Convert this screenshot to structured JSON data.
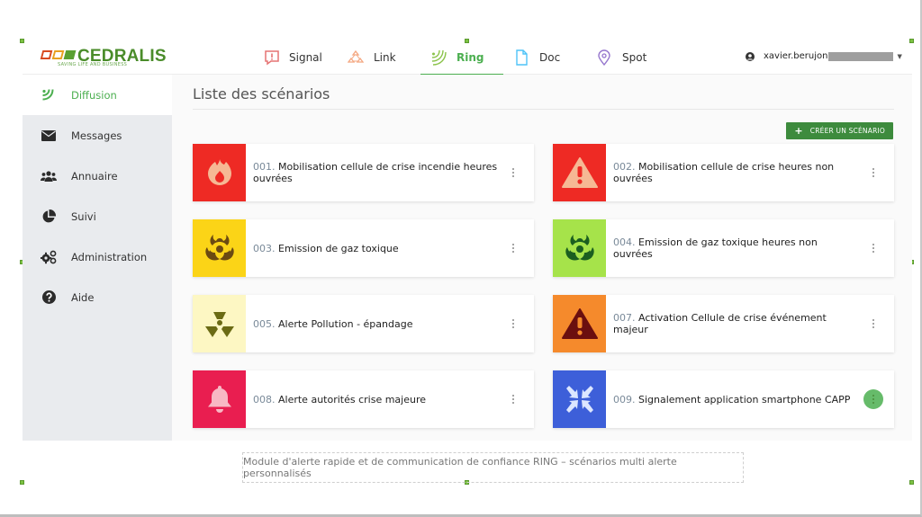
{
  "brand": {
    "name": "CEDRALIS",
    "tagline": "SAVING LIFE AND BUSINESS",
    "mark_colors": [
      "#d84a1f",
      "#e8a020",
      "#5aa032"
    ]
  },
  "nav": {
    "tabs": [
      {
        "label": "Signal",
        "icon": "signal-alert-icon",
        "color": "#e57373",
        "active": false
      },
      {
        "label": "Link",
        "icon": "link-network-icon",
        "color": "#f4a780",
        "active": false
      },
      {
        "label": "Ring",
        "icon": "ring-waves-icon",
        "color": "#8bc34a",
        "active": true
      },
      {
        "label": "Doc",
        "icon": "document-icon",
        "color": "#4fc3f7",
        "active": false
      },
      {
        "label": "Spot",
        "icon": "location-pin-icon",
        "color": "#9575cd",
        "active": false
      }
    ],
    "accent": "#4caf50"
  },
  "user": {
    "name": "xavier.berujon",
    "icon": "user-circle-icon"
  },
  "sidebar": {
    "items": [
      {
        "label": "Diffusion",
        "icon": "broadcast-icon",
        "active": true
      },
      {
        "label": "Messages",
        "icon": "envelope-icon",
        "active": false
      },
      {
        "label": "Annuaire",
        "icon": "users-icon",
        "active": false
      },
      {
        "label": "Suivi",
        "icon": "pie-chart-icon",
        "active": false
      },
      {
        "label": "Administration",
        "icon": "gears-icon",
        "active": false
      },
      {
        "label": "Aide",
        "icon": "question-circle-icon",
        "active": false
      }
    ]
  },
  "main": {
    "title": "Liste des scénarios",
    "create_button": "CRÉER UN SCÉNARIO",
    "scenarios": [
      {
        "num": "001.",
        "label": "Mobilisation cellule de crise incendie heures ouvrées",
        "icon": "fire-icon",
        "bg": "#ee2a24",
        "fg": "#f6b894",
        "menu_highlight": false
      },
      {
        "num": "002.",
        "label": "Mobilisation cellule de crise heures non ouvrées",
        "icon": "warning-triangle-icon",
        "bg": "#ee2a24",
        "fg": "#f6b894",
        "menu_highlight": false
      },
      {
        "num": "003.",
        "label": "Emission de gaz toxique",
        "icon": "biohazard-icon",
        "bg": "#fbd417",
        "fg": "#6b4a12",
        "menu_highlight": false
      },
      {
        "num": "004.",
        "label": "Emission de gaz toxique heures non ouvrées",
        "icon": "biohazard-icon",
        "bg": "#a6e34a",
        "fg": "#1b5e20",
        "menu_highlight": false
      },
      {
        "num": "005.",
        "label": "Alerte Pollution - épandage",
        "icon": "radiation-icon",
        "bg": "#fdf7c3",
        "fg": "#6b6b14",
        "menu_highlight": false
      },
      {
        "num": "007.",
        "label": "Activation Cellule de crise événement majeur",
        "icon": "warning-triangle-icon",
        "bg": "#f58a2c",
        "fg": "#6b0f0f",
        "menu_highlight": false
      },
      {
        "num": "008.",
        "label": "Alerte autorités crise majeure",
        "icon": "bell-icon",
        "bg": "#e91e50",
        "fg": "#f8b8c4",
        "menu_highlight": false
      },
      {
        "num": "009.",
        "label": "Signalement application smartphone CAPP",
        "icon": "compress-arrows-icon",
        "bg": "#3d5fd9",
        "fg": "#dce6ff",
        "menu_highlight": true
      }
    ]
  },
  "caption": "Module d'alerte rapide et de communication de confiance RING – scénarios multi alerte personnalisés"
}
